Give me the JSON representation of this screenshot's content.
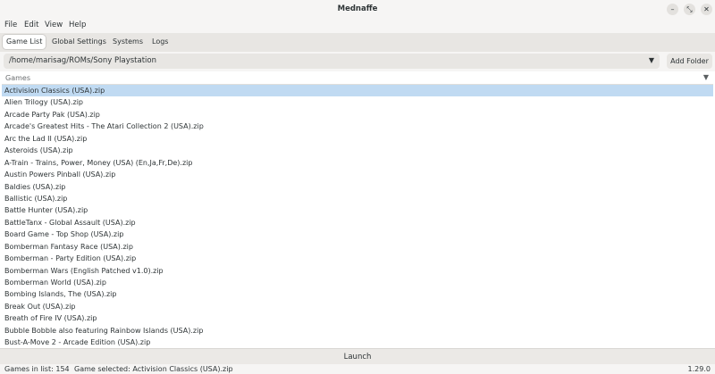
{
  "window": {
    "title": "Mednaffe"
  },
  "menu": [
    "File",
    "Edit",
    "View",
    "Help"
  ],
  "tabs": [
    "Game List",
    "Global Settings",
    "Systems",
    "Logs"
  ],
  "path": {
    "value": "/home/marisag/ROMs/Sony Playstation",
    "add_label": "Add Folder"
  },
  "list": {
    "header": "Games",
    "selected_index": 0,
    "items": [
      "Activision Classics (USA).zip",
      "Alien Trilogy (USA).zip",
      "Arcade Party Pak (USA).zip",
      "Arcade's Greatest Hits - The Atari Collection 2 (USA).zip",
      "Arc the Lad II (USA).zip",
      "Asteroids (USA).zip",
      "A-Train - Trains, Power, Money (USA) (En,Ja,Fr,De).zip",
      "Austin Powers Pinball (USA).zip",
      "Baldies (USA).zip",
      "Ballistic (USA).zip",
      "Battle Hunter (USA).zip",
      "BattleTanx - Global Assault (USA).zip",
      "Board Game - Top Shop (USA).zip",
      "Bomberman Fantasy Race (USA).zip",
      "Bomberman - Party Edition (USA).zip",
      "Bomberman Wars (English Patched v1.0).zip",
      "Bomberman World (USA).zip",
      "Bombing Islands, The (USA).zip",
      "Break Out (USA).zip",
      "Breath of Fire IV (USA).zip",
      "Bubble Bobble also featuring Rainbow Islands (USA).zip",
      "Bust-A-Move 2 - Arcade Edition (USA).zip"
    ]
  },
  "launch_label": "Launch",
  "status": {
    "games_in_list": "Games in list: 154",
    "game_selected": "Game selected: Activision Classics (USA).zip",
    "version": "1.29.0"
  }
}
